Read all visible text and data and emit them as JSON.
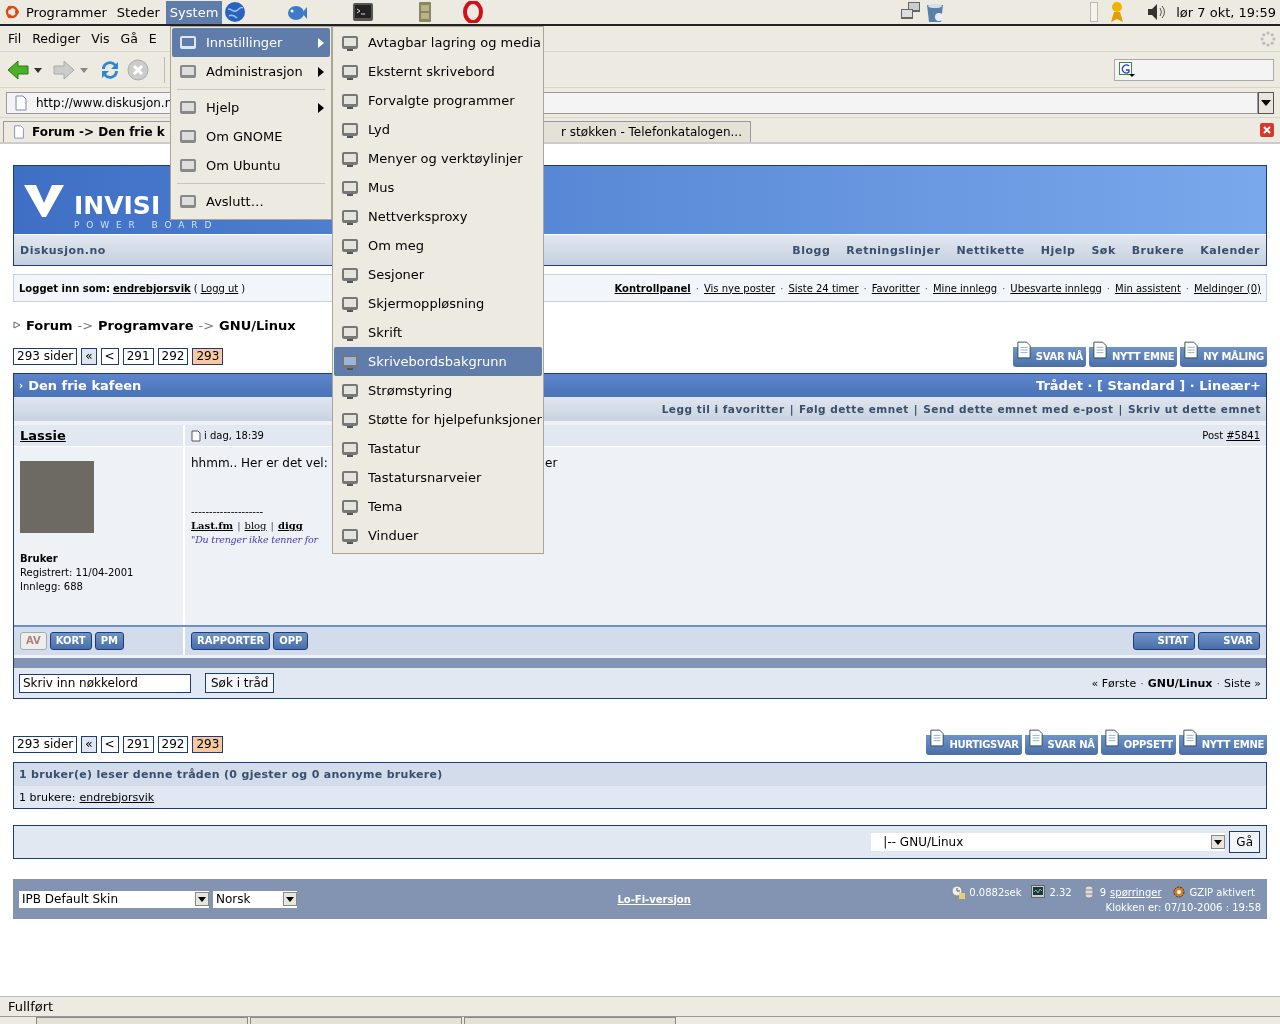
{
  "top_panel": {
    "menus": [
      {
        "label": "Programmer",
        "selected": false
      },
      {
        "label": "Steder",
        "selected": false
      },
      {
        "label": "System",
        "selected": true
      }
    ],
    "clock": "lør  7 okt, 19:59"
  },
  "browser": {
    "menubar": [
      "Fil",
      "Rediger",
      "Vis",
      "Gå",
      "E"
    ],
    "url": "http://www.diskusjon.n",
    "tabs": [
      {
        "label": "Forum -> Den frie k",
        "selected": true
      },
      {
        "label": "r støkken - Telefonkatalogen...",
        "selected": false
      }
    ],
    "status": "Fullført"
  },
  "system_menu": [
    {
      "kind": "item",
      "label": "Innstillinger",
      "selected": true,
      "submenu": true
    },
    {
      "kind": "item",
      "label": "Administrasjon",
      "selected": false,
      "submenu": true
    },
    {
      "kind": "separator"
    },
    {
      "kind": "item",
      "label": "Hjelp",
      "selected": false,
      "submenu": true
    },
    {
      "kind": "item",
      "label": "Om GNOME",
      "selected": false,
      "submenu": false
    },
    {
      "kind": "item",
      "label": "Om Ubuntu",
      "selected": false,
      "submenu": false
    },
    {
      "kind": "separator"
    },
    {
      "kind": "item",
      "label": "Avslutt…",
      "selected": false,
      "submenu": false
    }
  ],
  "settings_menu": [
    {
      "label": "Avtagbar lagring og media",
      "selected": false
    },
    {
      "label": "Eksternt skrivebord",
      "selected": false
    },
    {
      "label": "Forvalgte programmer",
      "selected": false
    },
    {
      "label": "Lyd",
      "selected": false
    },
    {
      "label": "Menyer og verktøylinjer",
      "selected": false
    },
    {
      "label": "Mus",
      "selected": false
    },
    {
      "label": "Nettverksproxy",
      "selected": false
    },
    {
      "label": "Om meg",
      "selected": false
    },
    {
      "label": "Sesjoner",
      "selected": false
    },
    {
      "label": "Skjermoppløsning",
      "selected": false
    },
    {
      "label": "Skrift",
      "selected": false
    },
    {
      "label": "Skrivebordsbakgrunn",
      "selected": true
    },
    {
      "label": "Strømstyring",
      "selected": false
    },
    {
      "label": "Støtte for hjelpefunksjoner",
      "selected": false
    },
    {
      "label": "Tastatur",
      "selected": false
    },
    {
      "label": "Tastatursnarveier",
      "selected": false
    },
    {
      "label": "Tema",
      "selected": false
    },
    {
      "label": "Vinduer",
      "selected": false
    }
  ],
  "forum": {
    "logo_text": "INVISI",
    "logo_subtext": "P O W E R   B O A R D",
    "site_name": "Diskusjon.no",
    "nav_links": [
      "Blogg",
      "Retningslinjer",
      "Nettikette",
      "Hjelp",
      "Søk",
      "Brukere",
      "Kalender"
    ],
    "logged_in": {
      "label": "Logget inn som:",
      "user": "endrebjorsvik",
      "paren_open": "(",
      "logout": "Logg ut",
      "paren_close": ")"
    },
    "user_links": [
      {
        "label": "Kontrollpanel",
        "separator": "·"
      },
      {
        "label": "Vis nye poster",
        "separator": "·"
      },
      {
        "label": "Siste 24 timer",
        "separator": "·"
      },
      {
        "label": "Favoritter",
        "separator": "·"
      },
      {
        "label": "Mine innlegg",
        "separator": "·"
      },
      {
        "label": "Ubesvarte innlegg",
        "separator": "·"
      },
      {
        "label": "Min assistent",
        "separator": "·"
      },
      {
        "label": "Meldinger (0)"
      }
    ],
    "breadcrumb": [
      {
        "label": "Forum",
        "separator": "->"
      },
      {
        "label": "Programvare",
        "separator": "->"
      },
      {
        "label": "GNU/Linux"
      }
    ],
    "pagination": {
      "label": "293 sider",
      "first": "«",
      "prev": "<",
      "pages": [
        {
          "label": "291",
          "selected": false
        },
        {
          "label": "292",
          "selected": false
        },
        {
          "label": "293",
          "selected": true
        }
      ]
    },
    "top_buttons": [
      "SVAR NÅ",
      "NYTT EMNE",
      "NY MÅLING"
    ],
    "thread": {
      "title_marker": "›",
      "title": "Den frie kafeen",
      "modes": "Trådet · [ Standard ] · Lineær+",
      "options": [
        {
          "label": "Legg til i favoritter",
          "separator": "|"
        },
        {
          "label": "Følg dette emnet",
          "separator": "|"
        },
        {
          "label": "Send dette emnet med e-post",
          "separator": "|"
        },
        {
          "label": "Skriv ut dette emnet"
        }
      ]
    },
    "post": {
      "author": "Lassie",
      "date": "i dag, 18:39",
      "number_label": "Post",
      "number": "#5841",
      "rank": "Bruker",
      "registered": "Registrert: 11/04-2001",
      "posts": "Innlegg: 688",
      "text_start": "hhmm.. Her er det vel:",
      "text_end": "er",
      "sig_rule": "--------------------",
      "sig_links": [
        {
          "label": "Last.fm",
          "bold": true,
          "separator": "|"
        },
        {
          "label": "blog",
          "bold": false,
          "separator": "|"
        },
        {
          "label": "digg",
          "bold": true
        }
      ],
      "sig_quote": "\"Du trenger ikke tenner for",
      "left_buttons": [
        {
          "label": "AV",
          "disabled": true
        },
        {
          "label": "KORT",
          "disabled": false
        },
        {
          "label": "PM",
          "disabled": false
        }
      ],
      "mid_buttons": [
        "RAPPORTER",
        "OPP"
      ],
      "right_buttons": [
        "SITAT",
        "SVAR"
      ]
    },
    "search": {
      "placeholder": "Skriv inn nøkkelord",
      "button": "Søk i tråd"
    },
    "topic_nav": [
      {
        "label": "« Første",
        "separator": "·"
      },
      {
        "label": "GNU/Linux",
        "separator": "·"
      },
      {
        "label": "Siste »"
      }
    ],
    "pagination_bottom": {
      "label": "293 sider",
      "first": "«",
      "prev": "<",
      "pages": [
        {
          "label": "291",
          "selected": false
        },
        {
          "label": "292",
          "selected": false
        },
        {
          "label": "293",
          "selected": true
        }
      ]
    },
    "bottom_buttons": [
      "HURTIGSVAR",
      "SVAR NÅ",
      "OPPSETT",
      "NYTT EMNE"
    ],
    "active_users": {
      "title": "1 bruker(e) leser denne tråden (0 gjester og 0 anonyme brukere)",
      "prefix": "1 brukere:",
      "user": "endrebjorsvik"
    },
    "forum_jump": {
      "value": "|-- GNU/Linux",
      "button": "Gå"
    },
    "footer": {
      "skin": "IPB Default Skin",
      "language": "Norsk",
      "lofi": "Lo-Fi-versjon",
      "stats": [
        {
          "kind": "time",
          "text": "0.0882sek"
        },
        {
          "kind": "load",
          "text": "2.32"
        },
        {
          "kind": "queries",
          "text": "9",
          "link": "spørringer"
        },
        {
          "kind": "gzip",
          "text": "GZIP aktivert"
        }
      ],
      "clock": "Klokken er: 07/10-2006 : 19:58"
    }
  }
}
